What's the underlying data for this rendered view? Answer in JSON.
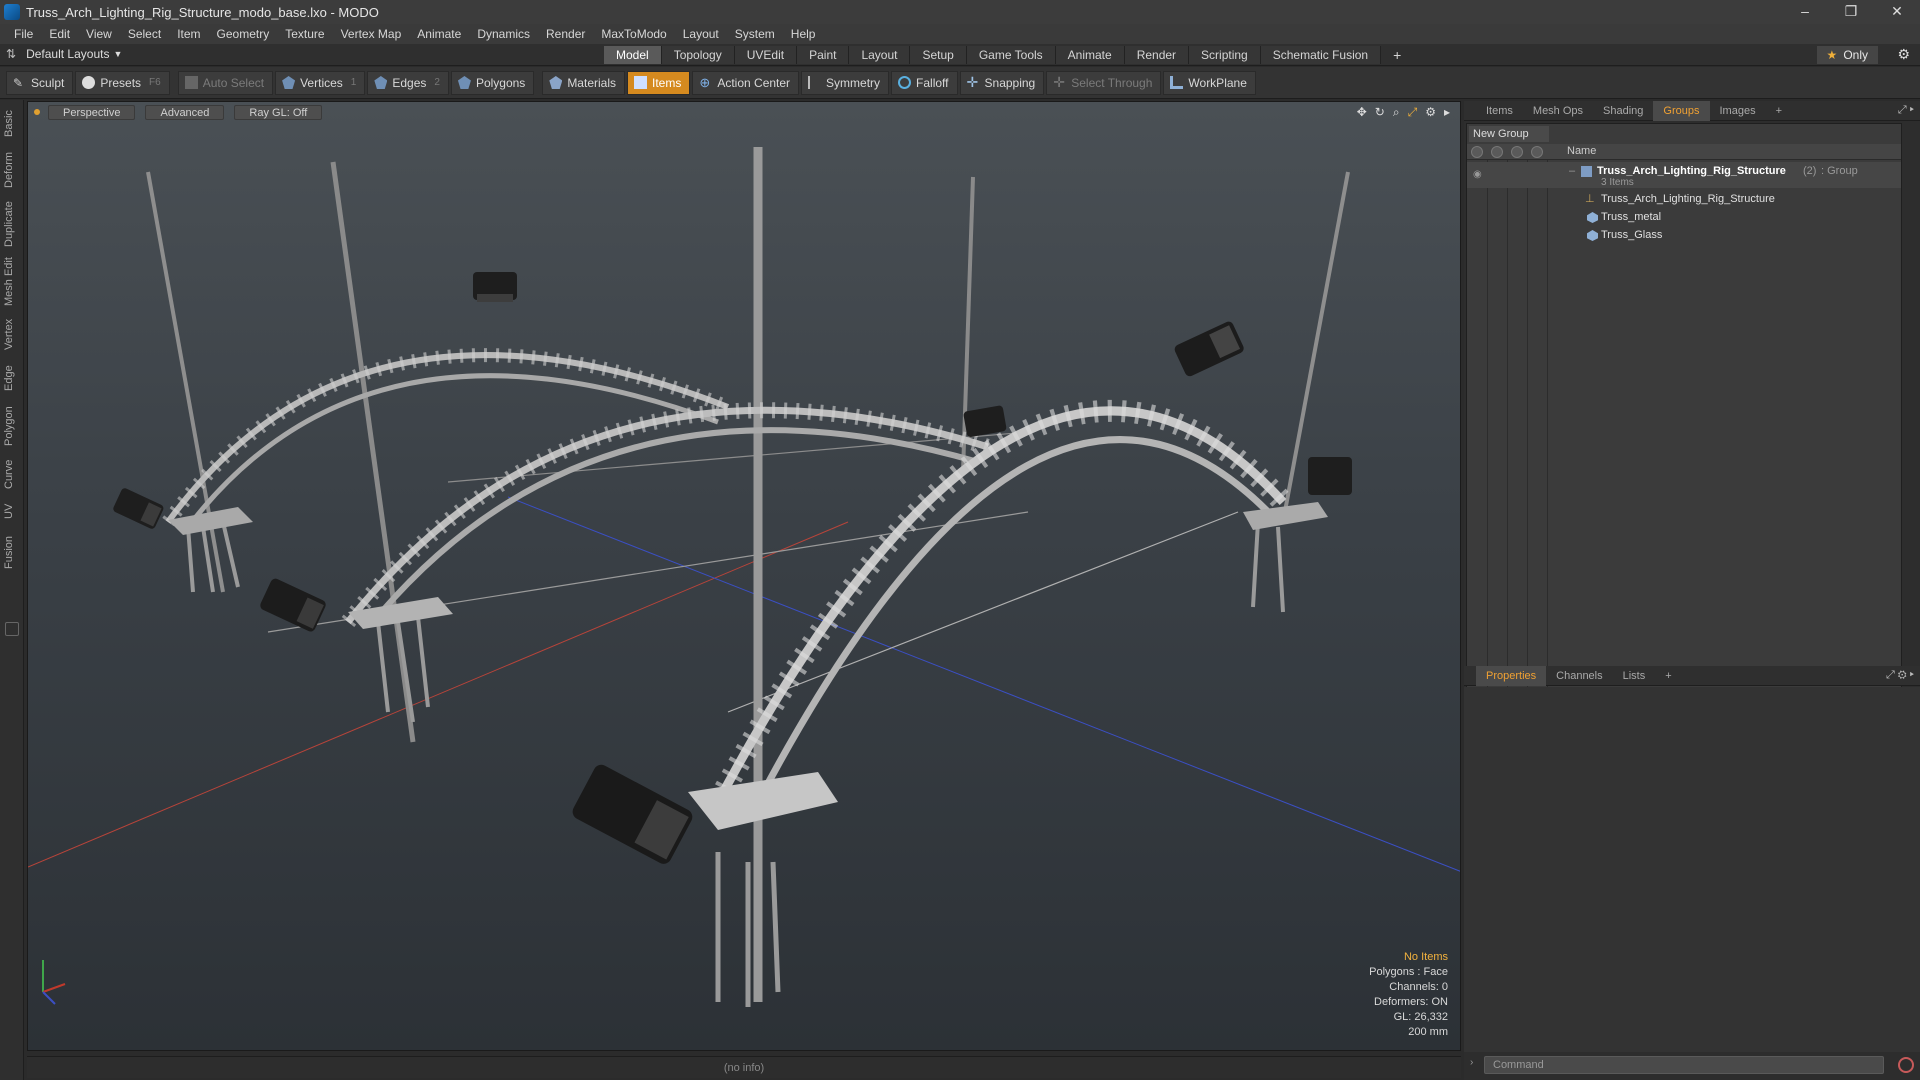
{
  "window": {
    "title": "Truss_Arch_Lighting_Rig_Structure_modo_base.lxo - MODO",
    "controls": [
      "–",
      "❐",
      "✕"
    ]
  },
  "menu": [
    "File",
    "Edit",
    "View",
    "Select",
    "Item",
    "Geometry",
    "Texture",
    "Vertex Map",
    "Animate",
    "Dynamics",
    "Render",
    "MaxToModo",
    "Layout",
    "System",
    "Help"
  ],
  "layout": {
    "dropdown": "Default Layouts",
    "tabs": [
      "Model",
      "Topology",
      "UVEdit",
      "Paint",
      "Layout",
      "Setup",
      "Game Tools",
      "Animate",
      "Render",
      "Scripting",
      "Schematic Fusion"
    ],
    "active_tab": "Model",
    "add": "+",
    "only": "Only"
  },
  "toolbar": {
    "sculpt": "Sculpt",
    "presets": "Presets",
    "presets_key": "F6",
    "auto_select": "Auto Select",
    "vertices": "Vertices",
    "vertices_key": "1",
    "edges": "Edges",
    "edges_key": "2",
    "polygons": "Polygons",
    "materials": "Materials",
    "items": "Items",
    "action_center": "Action Center",
    "symmetry": "Symmetry",
    "falloff": "Falloff",
    "snapping": "Snapping",
    "select_through": "Select Through",
    "workplane": "WorkPlane"
  },
  "left_tabs": [
    "Basic",
    "Deform",
    "Duplicate",
    "Mesh Edit",
    "Vertex",
    "Edge",
    "Polygon",
    "Curve",
    "UV",
    "Fusion"
  ],
  "viewport": {
    "view": "Perspective",
    "mode": "Advanced",
    "raygl": "Ray GL: Off",
    "info": {
      "status": "No Items",
      "polygons": "Polygons : Face",
      "channels": "Channels: 0",
      "deformers": "Deformers: ON",
      "gl": "GL: 26,332",
      "scale": "200 mm"
    }
  },
  "statusbar": "(no info)",
  "groups_panel": {
    "tabs": [
      "Items",
      "Mesh Ops",
      "Shading",
      "Groups",
      "Images"
    ],
    "active_tab": "Groups",
    "new_group": "New Group",
    "col_name": "Name",
    "group_name": "Truss_Arch_Lighting_Rig_Structure",
    "group_count": "(2)",
    "group_type": ": Group",
    "group_items": "3 Items",
    "children": [
      "Truss_Arch_Lighting_Rig_Structure",
      "Truss_metal",
      "Truss_Glass"
    ]
  },
  "properties_panel": {
    "tabs": [
      "Properties",
      "Channels",
      "Lists"
    ],
    "active_tab": "Properties"
  },
  "command": {
    "placeholder": "Command"
  },
  "colors": {
    "accent": "#d58a1f",
    "axis_x": "#c0392b",
    "axis_z": "#3b4fc4",
    "info_highlight": "#f3b33e"
  }
}
